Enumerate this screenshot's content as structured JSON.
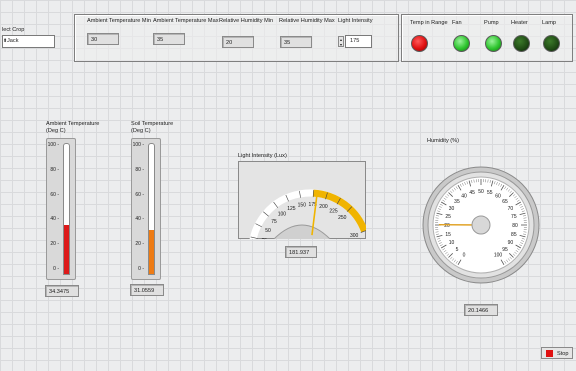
{
  "select_crop": {
    "label": "lect Crop",
    "value": "Jack"
  },
  "thresholds": {
    "ambient_temp_min": {
      "label": "Ambient Temperature Min",
      "value": "30"
    },
    "ambient_temp_max": {
      "label": "Ambient Temperature Max",
      "value": "35"
    },
    "rel_humidity_min": {
      "label": "Relative Humidity Min",
      "value": "20"
    },
    "rel_humidity_max": {
      "label": "Relative Humidity Max",
      "value": "35"
    },
    "light_intensity": {
      "label": "Light Intensity",
      "value": "175"
    }
  },
  "leds": [
    {
      "label": "Temp in Range",
      "color": "#e01010",
      "state": "on"
    },
    {
      "label": "Fan",
      "color": "#2ec52e",
      "state": "on"
    },
    {
      "label": "Pump",
      "color": "#2ec52e",
      "state": "on"
    },
    {
      "label": "Heater",
      "color": "#1f4a14",
      "state": "off"
    },
    {
      "label": "Lamp",
      "color": "#1f4a14",
      "state": "off"
    }
  ],
  "ambient_temperature": {
    "label_line1": "Ambient Temperature",
    "label_line2": "(Deg C)",
    "ticks": [
      "100",
      "80",
      "60",
      "40",
      "20",
      "0"
    ],
    "value": "34.3475",
    "level": 34.35,
    "fill_color": "#dd1a1a"
  },
  "soil_temperature": {
    "label_line1": "Soil Temperature",
    "label_line2": "(Deg C)",
    "ticks": [
      "100",
      "80",
      "60",
      "40",
      "20",
      "0"
    ],
    "value": "31.0559",
    "level": 31.06,
    "fill_color": "#ee7b14"
  },
  "light_gauge": {
    "label": "Light Intensity (Lux)",
    "ticks": [
      "0",
      "25",
      "50",
      "75",
      "100",
      "125",
      "150",
      "175",
      "200",
      "225",
      "250",
      "300"
    ],
    "value": "181.937",
    "needle_value": 181.937,
    "highlight_color": "#f0b400"
  },
  "humidity_gauge": {
    "label": "Humidity (%)",
    "ticks": [
      "0",
      "5",
      "10",
      "15",
      "20",
      "25",
      "30",
      "35",
      "40",
      "45",
      "50",
      "55",
      "60",
      "65",
      "70",
      "75",
      "80",
      "85",
      "90",
      "95",
      "100"
    ],
    "value": "20.1466",
    "needle_value": 20.1466,
    "needle_color": "#e0a020"
  },
  "stop_button": {
    "label": "Stop",
    "color": "#e01010"
  }
}
